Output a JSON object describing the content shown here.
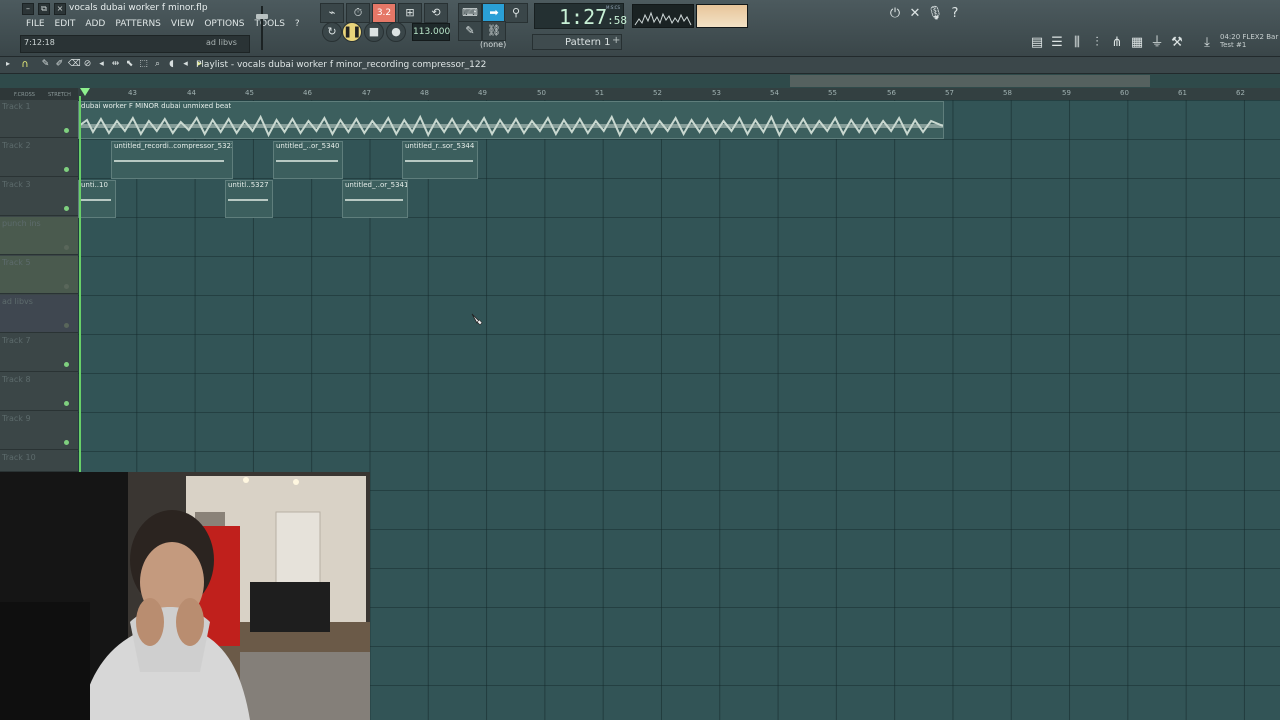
{
  "window": {
    "project_title": "vocals dubai worker f minor.flp",
    "controls": [
      "–",
      "⧉",
      "×"
    ]
  },
  "menu": {
    "items": [
      "FILE",
      "EDIT",
      "ADD",
      "PATTERNS",
      "VIEW",
      "OPTIONS",
      "TOOLS"
    ],
    "help": "?"
  },
  "hint_bar": {
    "time": "7:12:18",
    "name": "ad libvs"
  },
  "transport": {
    "time_main": "1:27",
    "time_sub": ":58",
    "time_label": "M:S:CS",
    "tempo": "113.000",
    "mode_badge": "3.2",
    "midi_none": "(none)",
    "pattern": "Pattern 1"
  },
  "news": {
    "line1": "04:20 FLEX2 Bar",
    "line2": "Test #1"
  },
  "playlist": {
    "title": "Playlist - vocals dubai worker f minor_recording compressor_122",
    "header_labels": [
      "F.CROSS",
      "STRETCH"
    ],
    "tracks": [
      {
        "name": "Track 1"
      },
      {
        "name": "Track 2"
      },
      {
        "name": "Track 3"
      },
      {
        "name": "punch ins"
      },
      {
        "name": "Track 5"
      },
      {
        "name": "ad libvs"
      },
      {
        "name": "Track 7"
      },
      {
        "name": "Track 8"
      },
      {
        "name": "Track 9"
      },
      {
        "name": "Track 10"
      }
    ],
    "bar_numbers": [
      "43",
      "44",
      "45",
      "46",
      "47",
      "48",
      "49",
      "50",
      "51",
      "52",
      "53",
      "54",
      "55",
      "56",
      "57",
      "58",
      "59",
      "60",
      "61",
      "62"
    ],
    "clips": [
      {
        "label": "dubai worker F MINOR dubai unmixed beat"
      },
      {
        "label": "untitled_recordi..compressor_5322"
      },
      {
        "label": "untitled_..or_5340"
      },
      {
        "label": "untitled_r..sor_5344"
      },
      {
        "label": "unti..10"
      },
      {
        "label": "untitl..5327"
      },
      {
        "label": "untitled_..or_5341"
      }
    ]
  },
  "colors": {
    "grid": "#325456",
    "clip_wave": "#c9d8d0",
    "playhead": "#68d068",
    "accent_on": "#e57767",
    "accent_blue": "#2a9fd6"
  }
}
